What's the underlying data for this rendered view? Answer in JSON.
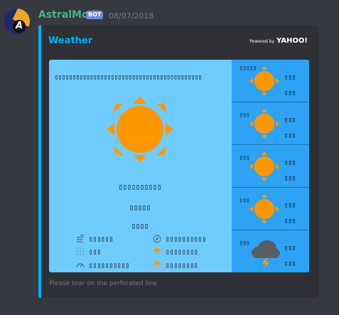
{
  "message": {
    "username": "AstralMod",
    "bot_tag": "BOT",
    "timestamp": "08/07/2018",
    "avatar_letter": "A"
  },
  "embed": {
    "title": "Weather",
    "powered_small": "Powered by",
    "powered_brand": "YAHOO!",
    "footer": "Please tear on the perforated line",
    "accent_color": "#00b0f4"
  },
  "weather": {
    "headline": "▯▯▯▯▯▯▯▯▯▯▯▯▯▯▯▯▯▯▯▯▯▯▯▯▯▯▯▯▯▯▯▯▯▯▯▯▯▯▯▯▯▯",
    "condition_icon": "sun-icon",
    "line1": "▯▯▯▯▯▯▯▯▯▯",
    "line2": "▯▯▯▯▯",
    "line3": "▯▯▯▯",
    "stats": {
      "wind": "▯▯▯▯▯▯",
      "direction": "▯▯▯▯▯▯▯▯▯▯",
      "humidity": "▯▯▯",
      "sunrise": "▯▯▯▯▯▯▯▯",
      "pressure": "▯▯▯▯▯▯▯▯▯▯",
      "sunset": "▯▯▯▯▯▯▯▯"
    }
  },
  "forecast": [
    {
      "day": "▯▯▯▯▯",
      "icon": "sun-icon",
      "high": "▯▯▯",
      "low": "▯▯▯"
    },
    {
      "day": "▯▯▯",
      "icon": "sun-icon",
      "high": "▯▯▯",
      "low": "▯▯▯"
    },
    {
      "day": "▯▯▯",
      "icon": "sun-icon",
      "high": "▯▯▯",
      "low": "▯▯▯"
    },
    {
      "day": "▯▯▯",
      "icon": "sun-icon",
      "high": "▯▯▯",
      "low": "▯▯▯"
    },
    {
      "day": "▯▯▯",
      "icon": "thunderstorm-icon",
      "high": "▯▯▯",
      "low": "▯▯▯"
    }
  ],
  "colors": {
    "username": "#43b581",
    "card_bg": "#6fcbfe",
    "forecast_bg": "#2ea3f5",
    "sun": "#ff9800"
  }
}
